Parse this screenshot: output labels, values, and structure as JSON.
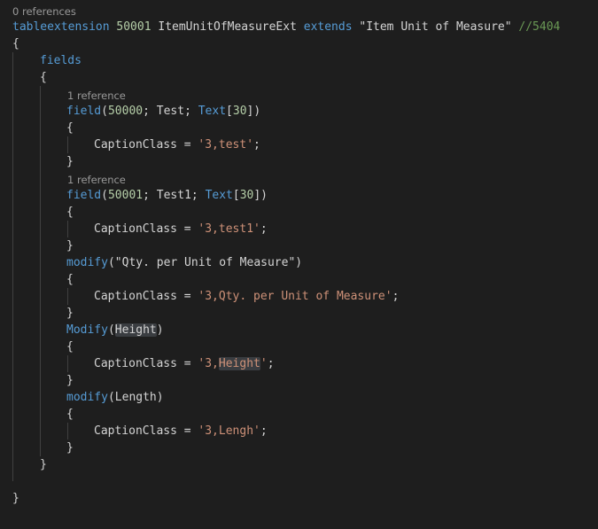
{
  "code_lens": {
    "table_refs": "0 references",
    "field1_refs": "1 reference",
    "field2_refs": "1 reference"
  },
  "header": {
    "kw_tableextension": "tableextension",
    "id": "50001",
    "name": "ItemUnitOfMeasureExt",
    "kw_extends": "extends",
    "target": "\"Item Unit of Measure\"",
    "comment": "//5404"
  },
  "braces": {
    "open": "{",
    "close": "}"
  },
  "fields_block": {
    "kw_fields": "fields"
  },
  "field1": {
    "kw": "field",
    "open_paren": "(",
    "id": "50000",
    "sep1": "; Test; ",
    "type": "Text",
    "len_open": "[",
    "len": "30",
    "len_close": "])",
    "prop": "CaptionClass = ",
    "value": "'3,test'",
    "end": ";"
  },
  "field2": {
    "kw": "field",
    "open_paren": "(",
    "id": "50001",
    "sep1": "; Test1; ",
    "type": "Text",
    "len_open": "[",
    "len": "30",
    "len_close": "])",
    "prop": "CaptionClass = ",
    "value": "'3,test1'",
    "end": ";"
  },
  "modify1": {
    "kw": "modify",
    "arg": "(\"Qty. per Unit of Measure\")",
    "prop": "CaptionClass = ",
    "value": "'3,Qty. per Unit of Measure'",
    "end": ";"
  },
  "modify2": {
    "kw": "Modify",
    "open_paren": "(",
    "arg": "Height",
    "close_paren": ")",
    "prop": "CaptionClass = ",
    "value_pre": "'3,",
    "value_hl": "Height",
    "value_post": "'",
    "end": ";"
  },
  "modify3": {
    "kw": "modify",
    "arg": "(Length)",
    "prop": "CaptionClass = ",
    "value": "'3,Lengh'",
    "end": ";"
  },
  "colors": {
    "background": "#1e1e1e",
    "keyword": "#569cd6",
    "number": "#b5cea8",
    "string": "#ce9178",
    "comment": "#6a9955",
    "text": "#d4d4d4"
  }
}
